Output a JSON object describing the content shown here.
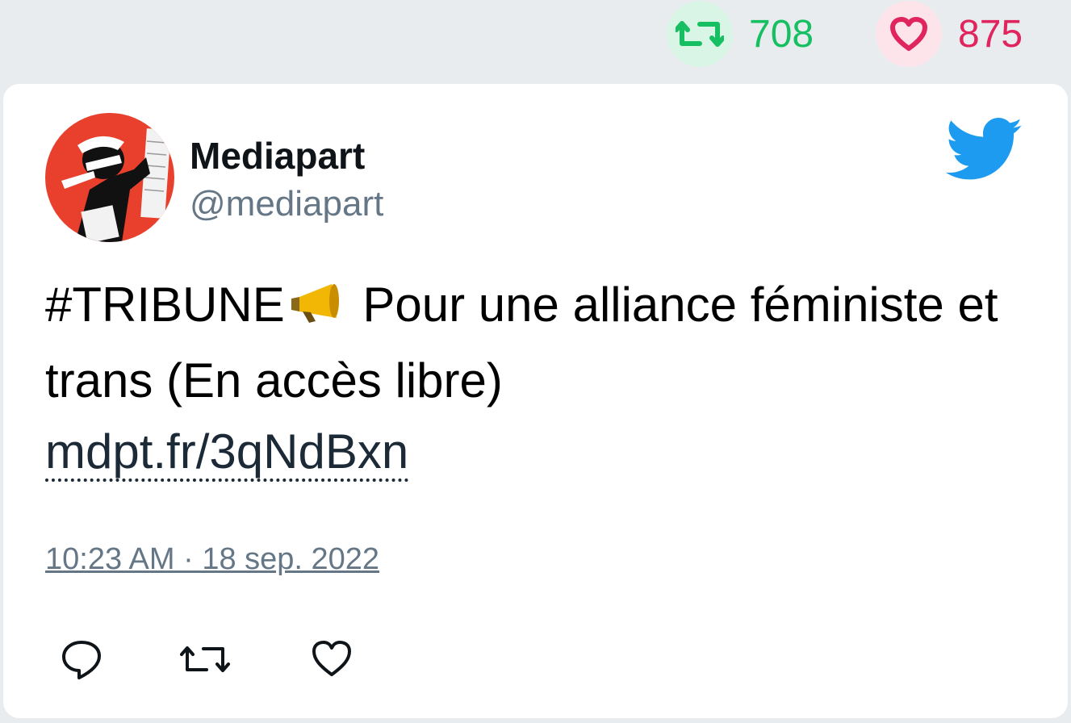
{
  "top_stats": {
    "retweets": "708",
    "likes": "875",
    "retweet_color": "#17bf63",
    "like_color": "#e0245e"
  },
  "tweet": {
    "author_name": "Mediapart",
    "author_handle": "@mediapart",
    "hashtag": "#TRIBUNE",
    "emoji": "megaphone-icon",
    "text_part1": "Pour une alliance féministe et trans (En accès libre)",
    "link": "mdpt.fr/3qNdBxn",
    "timestamp": "10:23 AM · 18 sep. 2022",
    "brand_color": "#1d9bf0"
  },
  "icons": {
    "logo": "twitter-bird-icon",
    "reply": "reply-icon",
    "retweet": "retweet-icon",
    "like": "heart-icon"
  }
}
